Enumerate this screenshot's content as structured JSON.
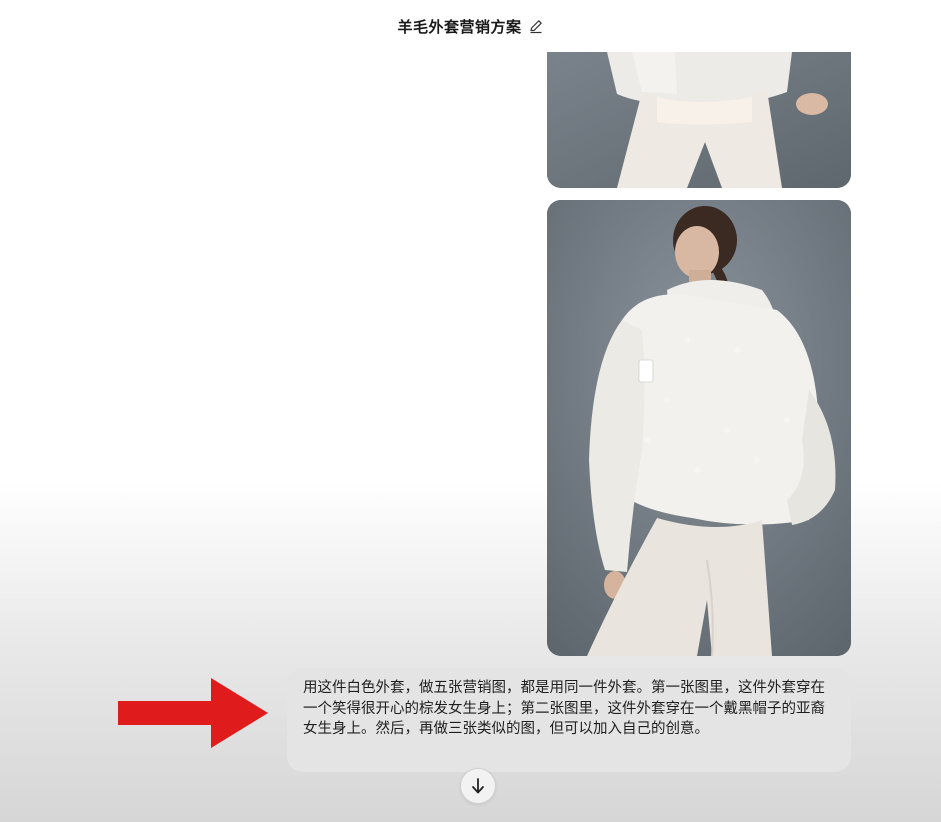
{
  "header": {
    "title": "羊毛外套营销方案",
    "edit_icon": "pencil-icon"
  },
  "images": [
    {
      "name": "generated-image-1",
      "description_icon": "image"
    },
    {
      "name": "generated-image-2",
      "description_icon": "image"
    }
  ],
  "prompt": {
    "text": "用这件白色外套，做五张营销图，都是用同一件外套。第一张图里，这件外套穿在一个笑得很开心的棕发女生身上；第二张图里，这件外套穿在一个戴黑帽子的亚裔女生身上。然后，再做三张类似的图，但可以加入自己的创意。"
  },
  "annotation": {
    "arrow_color": "#e01b1b"
  },
  "scroll_button": {
    "icon": "arrow-down-icon"
  },
  "colors": {
    "image_background": "#6f7880",
    "bubble_background": "#e4e4e4"
  }
}
